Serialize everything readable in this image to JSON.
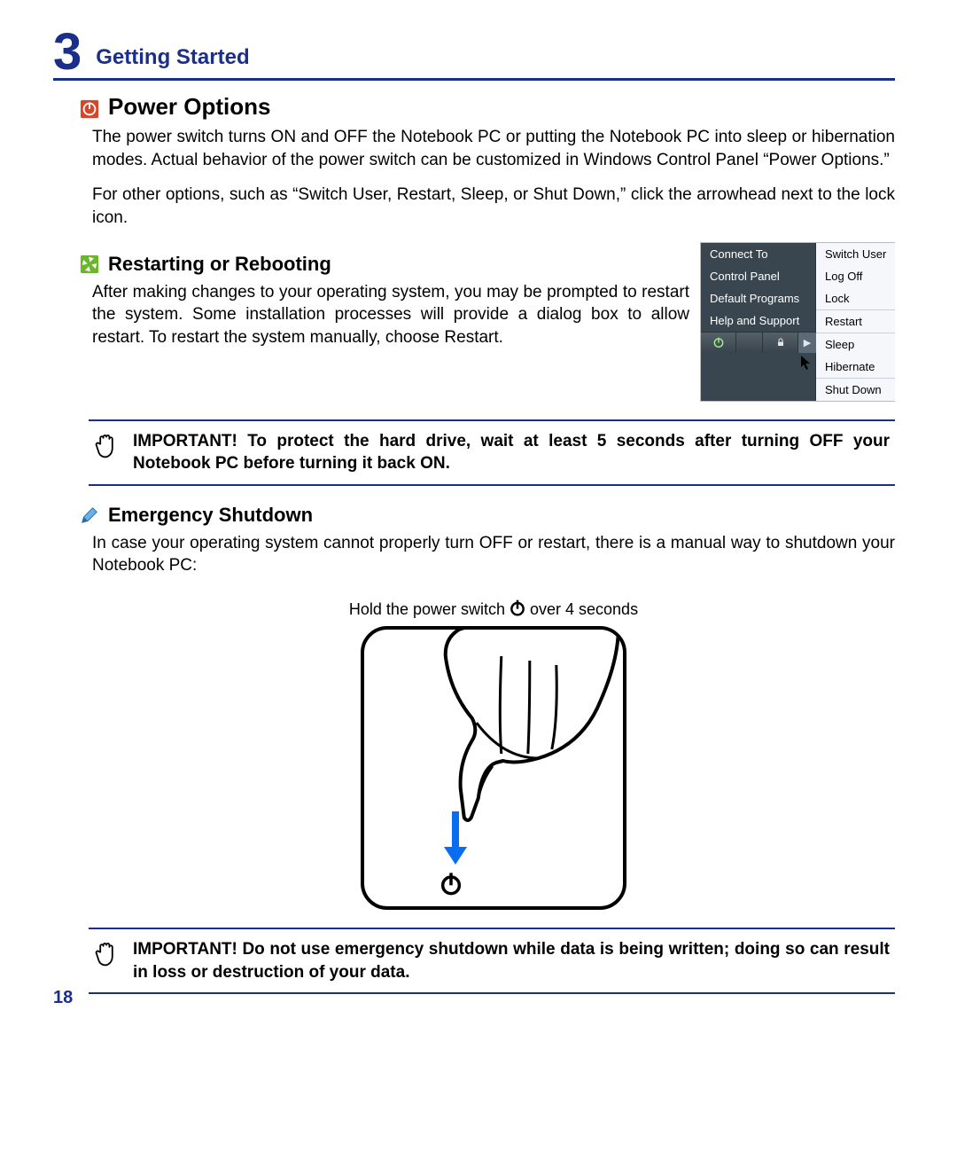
{
  "chapter": {
    "number": "3",
    "title": "Getting Started"
  },
  "sections": {
    "power_options": {
      "heading": "Power Options",
      "p1": "The power switch turns ON and OFF the Notebook PC or putting the Notebook PC into sleep or hibernation modes. Actual behavior of the power switch can be customized in Windows Control Panel “Power Options.”",
      "p2": "For other options, such as “Switch User, Restart, Sleep, or Shut Down,” click the arrowhead next to the lock icon."
    },
    "restarting": {
      "heading": "Restarting or Rebooting",
      "p1": "After making changes to your operating system, you may be prompted to restart the system. Some installation processes will provide a dialog box to allow restart. To restart the system manually, choose Restart."
    },
    "emergency": {
      "heading": "Emergency Shutdown",
      "p1": "In case your operating system cannot properly turn OFF or restart, there is a manual way to shutdown your Notebook PC:",
      "caption_pre": "Hold the power switch ",
      "caption_post": " over 4 seconds"
    }
  },
  "notes": {
    "hdd_wait": "IMPORTANT!  To protect the hard drive, wait at least 5 seconds after turning OFF your Notebook PC before turning it back ON.",
    "data_loss": "IMPORTANT!  Do not use emergency shutdown while data is being written; doing so can result in loss or destruction of your data."
  },
  "start_menu": {
    "left": [
      "Connect To",
      "Control Panel",
      "Default Programs",
      "Help and Support"
    ],
    "right": [
      "Switch User",
      "Log Off",
      "Lock",
      "Restart",
      "Sleep",
      "Hibernate",
      "Shut Down"
    ]
  },
  "page_number": "18"
}
